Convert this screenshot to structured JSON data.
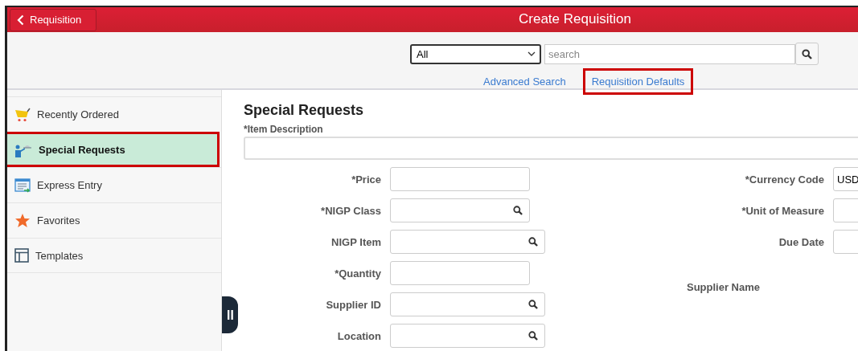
{
  "header": {
    "back_button": "Requisition",
    "title": "Create Requisition"
  },
  "search": {
    "scope": "All",
    "placeholder": "search",
    "links": [
      {
        "label": "Advanced Search",
        "highlighted": false
      },
      {
        "label": "Requisition Defaults",
        "highlighted": true
      }
    ]
  },
  "sidebar": {
    "items": [
      {
        "label": "Recently Ordered",
        "kind": "cart",
        "selected": false,
        "highlighted": false
      },
      {
        "label": "Special Requests",
        "kind": "request",
        "selected": true,
        "highlighted": true
      },
      {
        "label": "Express Entry",
        "kind": "express",
        "selected": false,
        "highlighted": false
      },
      {
        "label": "Favorites",
        "kind": "star",
        "selected": false,
        "highlighted": false
      },
      {
        "label": "Templates",
        "kind": "template",
        "selected": false,
        "highlighted": false
      }
    ]
  },
  "form": {
    "title": "Special Requests",
    "description_label": "*Item Description",
    "left_fields": [
      {
        "label": "*Price",
        "kind": "text"
      },
      {
        "label": "*NIGP Class",
        "kind": "lookup"
      },
      {
        "label": "NIGP Item",
        "kind": "lookup_wide"
      },
      {
        "label": "*Quantity",
        "kind": "text"
      },
      {
        "label": "Supplier ID",
        "kind": "lookup_wide"
      },
      {
        "label": "Location",
        "kind": "lookup_wide"
      }
    ],
    "right_fields": [
      {
        "label": "*Currency Code",
        "kind": "text",
        "value": "USD"
      },
      {
        "label": "*Unit of Measure",
        "kind": "text"
      },
      {
        "label": "Due Date",
        "kind": "text"
      },
      {
        "label": "Supplier Name",
        "kind": "label"
      }
    ]
  }
}
